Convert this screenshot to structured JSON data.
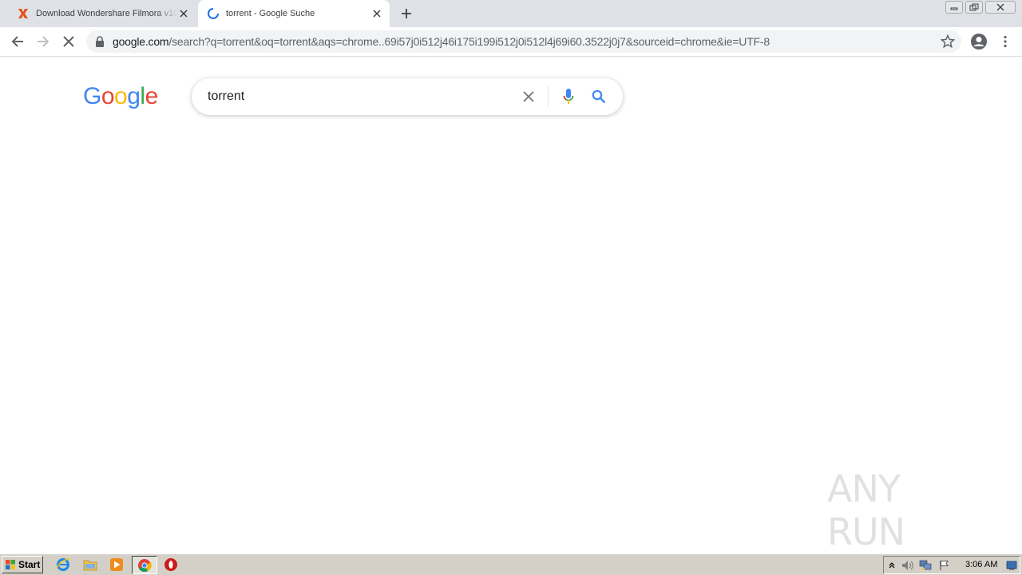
{
  "browser": {
    "tabs": [
      {
        "title": "Download Wondershare Filmora v10",
        "favicon": "x-brand-icon",
        "active": false
      },
      {
        "title": "torrent - Google Suche",
        "favicon": "loading-spinner-icon",
        "active": true
      }
    ],
    "url_host": "google.com",
    "url_rest": "/search?q=torrent&oq=torrent&aqs=chrome..69i57j0i512j46i175i199i512j0i512l4j69i60.3522j0j7&sourceid=chrome&ie=UTF-8"
  },
  "page": {
    "logo": [
      "G",
      "o",
      "o",
      "g",
      "l",
      "e"
    ],
    "logo_colors": [
      "#4285f4",
      "#ea4335",
      "#fbbc05",
      "#4285f4",
      "#34a853",
      "#ea4335"
    ],
    "search_query": "torrent"
  },
  "watermark": "ANY RUN",
  "taskbar": {
    "start_label": "Start",
    "clock": "3:06 AM"
  }
}
